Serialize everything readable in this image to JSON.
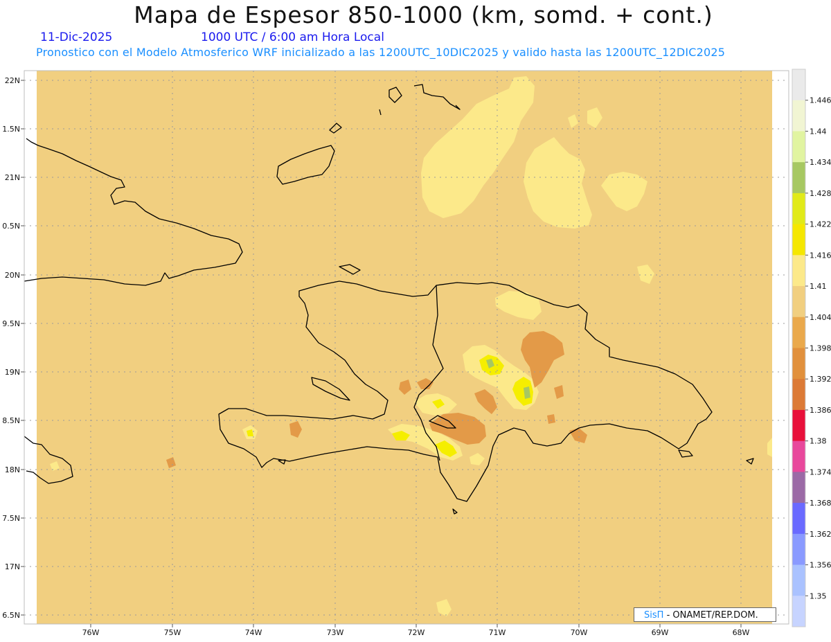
{
  "header": {
    "title": "Mapa de Espesor 850-1000 (km, somd. + cont.)",
    "date": "11-Dic-2025",
    "time": "1000 UTC / 6:00 am Hora Local",
    "description": "Pronostico con el Modelo Atmosferico WRF inicializado a las 1200UTC_10DIC2025 y valido hasta las  1200UTC_12DIC2025"
  },
  "axes": {
    "lat_labels": [
      "22N",
      "1.5N",
      "21N",
      "0.5N",
      "20N",
      "9.5N",
      "19N",
      "8.5N",
      "18N",
      "7.5N",
      "17N",
      "6.5N"
    ],
    "lon_labels": [
      "76W",
      "75W",
      "74W",
      "73W",
      "72W",
      "71W",
      "70W",
      "69W",
      "68W"
    ]
  },
  "colorbar": {
    "labels": [
      "1.446",
      "1.44",
      "1.434",
      "1.428",
      "1.422",
      "1.416",
      "1.41",
      "1.404",
      "1.398",
      "1.392",
      "1.386",
      "1.38",
      "1.374",
      "1.368",
      "1.362",
      "1.356",
      "1.35"
    ],
    "colors": [
      "#eaeaea",
      "#f1f5d3",
      "#e1f4a1",
      "#a7c862",
      "#e1ea19",
      "#f5e700",
      "#fce98a",
      "#f1cf80",
      "#eaa94c",
      "#e1903c",
      "#dc7a36",
      "#e8103a",
      "#e8489c",
      "#9b6aa6",
      "#6a6aff",
      "#8a9aff",
      "#aac2ff",
      "#c7d4ff"
    ]
  },
  "map": {
    "background": "#f1cf80",
    "light_band": "#fce98a",
    "warm_band": "#e39a48",
    "yellow_band": "#f5ee00",
    "green_band": "#a7c862"
  },
  "credit": {
    "logo_text": "SisΠ",
    "text": "- ONAMET/REP.DOM."
  }
}
